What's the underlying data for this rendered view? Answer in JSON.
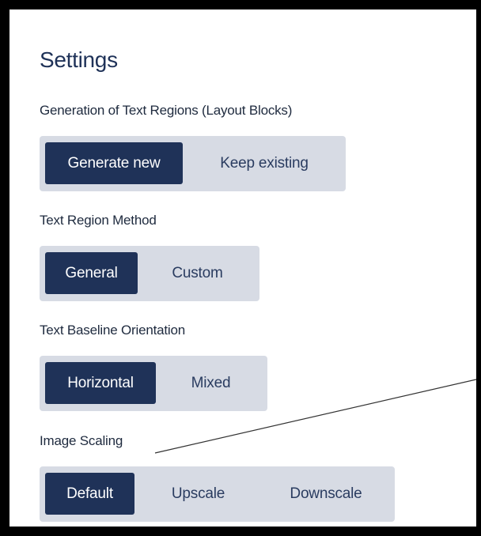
{
  "settings": {
    "title": "Settings",
    "sections": [
      {
        "label": "Generation of Text Regions (Layout Blocks)",
        "options": [
          "Generate new",
          "Keep existing"
        ],
        "selected": "Generate new"
      },
      {
        "label": "Text Region Method",
        "options": [
          "General",
          "Custom"
        ],
        "selected": "General"
      },
      {
        "label": "Text Baseline Orientation",
        "options": [
          "Horizontal",
          "Mixed"
        ],
        "selected": "Horizontal"
      },
      {
        "label": "Image Scaling",
        "options": [
          "Default",
          "Upscale",
          "Downscale"
        ],
        "selected": "Default"
      }
    ]
  },
  "colors": {
    "accent": "#1f3258",
    "segment_bg": "#d7dbe4",
    "outer_bg": "#f3efe6"
  }
}
